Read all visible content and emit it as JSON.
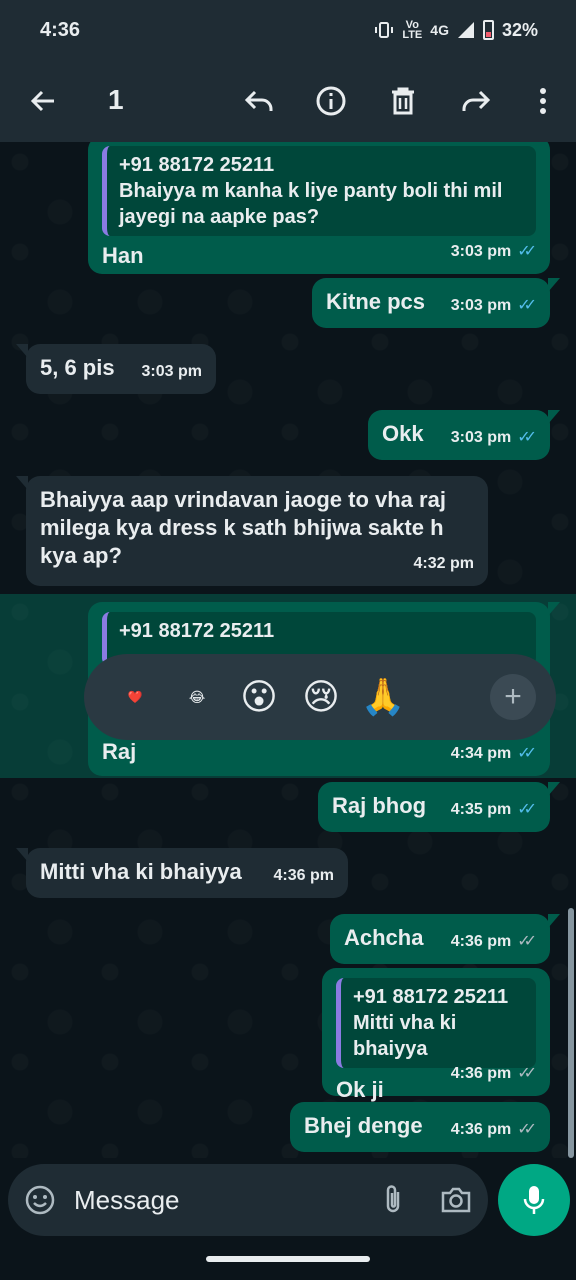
{
  "status": {
    "time": "4:36",
    "volte": "Vo\nLTE",
    "network": "4G",
    "battery": "32%"
  },
  "toolbar": {
    "selected_count": "1",
    "icons": [
      "back-arrow-icon",
      "reply-icon",
      "info-icon",
      "delete-icon",
      "forward-icon",
      "more-icon"
    ]
  },
  "messages": [
    {
      "dir": "out",
      "quote_name": "+91 88172 25211",
      "quote_text": "Bhaiyya m kanha k liye panty boli thi mil jayegi na aapke pas?",
      "text": "Han",
      "time": "3:03 pm",
      "read": true
    },
    {
      "dir": "out",
      "text": "Kitne pcs",
      "time": "3:03 pm",
      "read": true
    },
    {
      "dir": "in",
      "text": "5, 6 pis",
      "time": "3:03 pm"
    },
    {
      "dir": "out",
      "text": "Okk",
      "time": "3:03 pm",
      "read": true
    },
    {
      "dir": "in",
      "text": "Bhaiyya aap vrindavan jaoge to vha raj milega kya dress k sath bhijwa sakte h kya ap?",
      "time": "4:32 pm"
    },
    {
      "dir": "out",
      "selected": true,
      "quote_name": "+91 88172 25211",
      "text": "Raj",
      "time": "4:34 pm",
      "read": true
    },
    {
      "dir": "out",
      "text": "Raj bhog",
      "time": "4:35 pm",
      "read": true
    },
    {
      "dir": "in",
      "text": "Mitti vha ki bhaiyya",
      "time": "4:36 pm"
    },
    {
      "dir": "out",
      "text": "Achcha",
      "time": "4:36 pm",
      "read": false
    },
    {
      "dir": "out",
      "quote_name": "+91 88172 25211",
      "quote_text": "Mitti vha ki bhaiyya",
      "text": "Ok ji",
      "time": "4:36 pm",
      "read": false
    },
    {
      "dir": "out",
      "text": "Bhej denge",
      "time": "4:36 pm",
      "read": false
    }
  ],
  "reactions": [
    "❤️",
    "😂",
    "😮",
    "😢",
    "🙏"
  ],
  "composer": {
    "placeholder": "Message"
  },
  "colors": {
    "outgoing": "#005c4b",
    "incoming": "#1f2c34",
    "accent": "#00a884",
    "read_ticks": "#53bdeb"
  }
}
